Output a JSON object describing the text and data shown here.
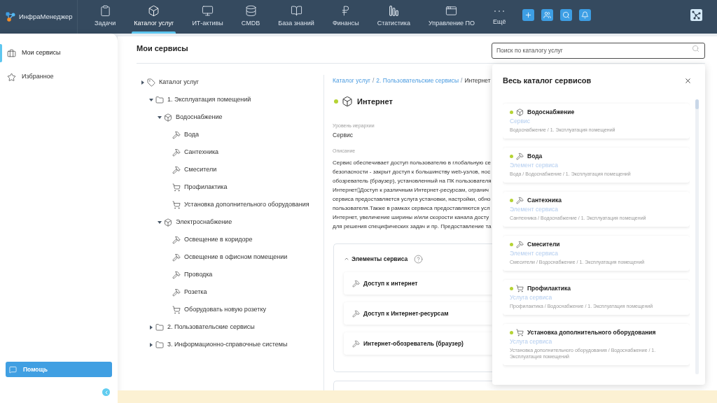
{
  "app": {
    "name": "ИнфраМенеджер"
  },
  "nav": [
    {
      "label": "Задачи",
      "selected": false
    },
    {
      "label": "Каталог услуг",
      "selected": true
    },
    {
      "label": "ИТ-активы",
      "selected": false
    },
    {
      "label": "CMDB",
      "selected": false
    },
    {
      "label": "База знаний",
      "selected": false
    },
    {
      "label": "Финансы",
      "selected": false
    },
    {
      "label": "Статистика",
      "selected": false
    },
    {
      "label": "Управление ПО",
      "selected": false
    },
    {
      "label": "Ещё",
      "selected": false
    }
  ],
  "sidebar": {
    "items": [
      {
        "label": "Мои сервисы",
        "selected": true
      },
      {
        "label": "Избранное",
        "selected": false
      }
    ],
    "help_button": "Помощь"
  },
  "page": {
    "title": "Мои сервисы",
    "search": {
      "placeholder": "Поиск по каталогу услуг"
    }
  },
  "tree": [
    {
      "label": "Каталог услуг",
      "kind": "catalog",
      "expanded": false,
      "children": [
        {
          "label": "1. Эксплуатация помещений",
          "kind": "folder",
          "expanded": true,
          "children": [
            {
              "label": "Водоснабжение",
              "kind": "service",
              "expanded": true,
              "children": [
                {
                  "label": "Вода",
                  "kind": "element"
                },
                {
                  "label": "Сантехника",
                  "kind": "element"
                },
                {
                  "label": "Смесители",
                  "kind": "element"
                },
                {
                  "label": "Профилактика",
                  "kind": "offering"
                },
                {
                  "label": "Установка дополнительного оборудования",
                  "kind": "offering"
                }
              ]
            },
            {
              "label": "Электроснабжение",
              "kind": "service",
              "expanded": true,
              "children": [
                {
                  "label": "Освещение в коридоре",
                  "kind": "element"
                },
                {
                  "label": "Освещение в офисном помещении",
                  "kind": "element"
                },
                {
                  "label": "Проводка",
                  "kind": "element"
                },
                {
                  "label": "Розетка",
                  "kind": "element"
                },
                {
                  "label": "Оборудовать новую розетку",
                  "kind": "offering"
                }
              ]
            }
          ]
        },
        {
          "label": "2. Пользовательские сервисы",
          "kind": "folder",
          "expanded": false
        },
        {
          "label": "3. Информационно-справочные системы",
          "kind": "folder",
          "expanded": false
        }
      ]
    }
  ],
  "detail": {
    "breadcrumb": [
      {
        "kind": "link",
        "text": "Каталог услуг"
      },
      {
        "kind": "separator",
        "text": "/"
      },
      {
        "kind": "link",
        "text": "2. Пользовательские сервисы"
      },
      {
        "kind": "separator",
        "text": "/"
      },
      {
        "kind": "current",
        "text": "Интернет"
      }
    ],
    "title": "Интернет",
    "kind": "service",
    "active": true,
    "fields": [
      {
        "label": "Уровень иерархии",
        "value": "Сервис"
      }
    ],
    "description": {
      "label": "Описание",
      "lines": [
        "Сервис обеспечивает доступ пользователю в глобальную се",
        "безопасности - закрыт доступ к большинству web-узлов, нос",
        "обозреватель (браузер), установленный на ПК пользователя",
        "Интернет▯Доступ к различным Интернет-ресурсам, огранич",
        "сервиса предоставляется услуга установки, настройки, обно",
        "пользователя.Также в рамках сервиса предоставляются усл",
        "Интернет, увеличение ширины и/или скорости канала досту",
        "для решения специфических задач и пр. Предоставление та"
      ]
    },
    "elements": {
      "title": "Элементы сервиса",
      "expanded": true,
      "items": [
        {
          "label": "Доступ к интернет",
          "kind": "element"
        },
        {
          "label": "Доступ к Интернет-ресурсам",
          "kind": "element"
        },
        {
          "label": "Интернет-обозреватель (браузер)",
          "kind": "element"
        }
      ]
    }
  },
  "catalog_panel": {
    "title": "Весь каталог сервисов",
    "items": [
      {
        "name": "Водоснабжение",
        "kind": "service",
        "active": true,
        "type": "Сервис",
        "path": "Водоснабжение / 1. Эксплуатация помещений"
      },
      {
        "name": "Вода",
        "kind": "element",
        "active": true,
        "type": "Элемент сервиса",
        "path": "Вода / Водоснабжение / 1. Эксплуатация помещений"
      },
      {
        "name": "Сантехника",
        "kind": "element",
        "active": true,
        "type": "Элемент сервиса",
        "path": "Сантехника / Водоснабжение / 1. Эксплуатация помещений"
      },
      {
        "name": "Смесители",
        "kind": "element",
        "active": true,
        "type": "Элемент сервиса",
        "path": "Смесители / Водоснабжение / 1. Эксплуатация помещений"
      },
      {
        "name": "Профилактика",
        "kind": "offering",
        "active": true,
        "type": "Услуга сервиса",
        "path": "Профилактика / Водоснабжение / 1. Эксплуатация помещений"
      },
      {
        "name": "Установка дополнительного оборудования",
        "kind": "offering",
        "active": true,
        "type": "Услуга сервиса",
        "path": "Установка дополнительного оборудования / Водоснабжение / 1. Эксплуатация помещений"
      }
    ]
  }
}
